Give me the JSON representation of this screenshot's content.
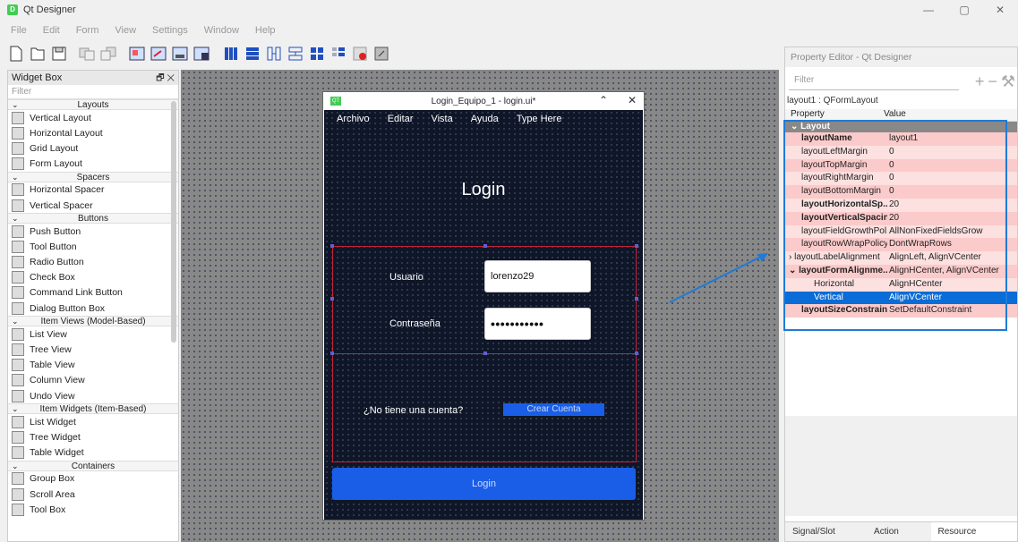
{
  "app": {
    "title": "Qt Designer"
  },
  "window_controls": {
    "minimize": "—",
    "restore": "▢",
    "close": "✕"
  },
  "menu": [
    "File",
    "Edit",
    "Form",
    "View",
    "Settings",
    "Window",
    "Help"
  ],
  "widget_box": {
    "title": "Widget Box",
    "filter_placeholder": "Filter",
    "items": [
      {
        "type": "cat",
        "label": "Layouts"
      },
      {
        "type": "item",
        "label": "Vertical Layout",
        "icon": "vertical-layout-icon"
      },
      {
        "type": "item",
        "label": "Horizontal Layout",
        "icon": "horizontal-layout-icon"
      },
      {
        "type": "item",
        "label": "Grid Layout",
        "icon": "grid-layout-icon"
      },
      {
        "type": "item",
        "label": "Form Layout",
        "icon": "form-layout-icon"
      },
      {
        "type": "cat",
        "label": "Spacers"
      },
      {
        "type": "item",
        "label": "Horizontal Spacer",
        "icon": "horizontal-spacer-icon"
      },
      {
        "type": "item",
        "label": "Vertical Spacer",
        "icon": "vertical-spacer-icon"
      },
      {
        "type": "cat",
        "label": "Buttons"
      },
      {
        "type": "item",
        "label": "Push Button",
        "icon": "push-button-icon"
      },
      {
        "type": "item",
        "label": "Tool Button",
        "icon": "tool-button-icon"
      },
      {
        "type": "item",
        "label": "Radio Button",
        "icon": "radio-button-icon"
      },
      {
        "type": "item",
        "label": "Check Box",
        "icon": "check-box-icon"
      },
      {
        "type": "item",
        "label": "Command Link Button",
        "icon": "command-link-icon"
      },
      {
        "type": "item",
        "label": "Dialog Button Box",
        "icon": "dialog-button-box-icon"
      },
      {
        "type": "cat",
        "label": "Item Views (Model-Based)"
      },
      {
        "type": "item",
        "label": "List View",
        "icon": "list-view-icon"
      },
      {
        "type": "item",
        "label": "Tree View",
        "icon": "tree-view-icon"
      },
      {
        "type": "item",
        "label": "Table View",
        "icon": "table-view-icon"
      },
      {
        "type": "item",
        "label": "Column View",
        "icon": "column-view-icon"
      },
      {
        "type": "item",
        "label": "Undo View",
        "icon": "undo-view-icon"
      },
      {
        "type": "cat",
        "label": "Item Widgets (Item-Based)"
      },
      {
        "type": "item",
        "label": "List Widget",
        "icon": "list-widget-icon"
      },
      {
        "type": "item",
        "label": "Tree Widget",
        "icon": "tree-widget-icon"
      },
      {
        "type": "item",
        "label": "Table Widget",
        "icon": "table-widget-icon"
      },
      {
        "type": "cat",
        "label": "Containers"
      },
      {
        "type": "item",
        "label": "Group Box",
        "icon": "group-box-icon"
      },
      {
        "type": "item",
        "label": "Scroll Area",
        "icon": "scroll-area-icon"
      },
      {
        "type": "item",
        "label": "Tool Box",
        "icon": "tool-box-icon"
      }
    ]
  },
  "form": {
    "window_title": "Login_Equipo_1 - login.ui*",
    "menu": [
      "Archivo",
      "Editar",
      "Vista",
      "Ayuda",
      "Type Here"
    ],
    "heading": "Login",
    "user_label": "Usuario",
    "user_value": "lorenzo29",
    "password_label": "Contraseña",
    "password_value": "•••••••••••",
    "no_account_label": "¿No tiene una cuenta?",
    "create_account_button": "Crear Cuenta",
    "login_button": "Login"
  },
  "property_editor": {
    "title": "Property Editor - Qt Designer",
    "filter_placeholder": "Filter",
    "object": "layout1 : QFormLayout",
    "col_property": "Property",
    "col_value": "Value",
    "group": "Layout",
    "rows": [
      {
        "k": "layoutName",
        "v": "layout1",
        "bold": true,
        "shade": "a"
      },
      {
        "k": "layoutLeftMargin",
        "v": "0",
        "bold": false,
        "shade": "b"
      },
      {
        "k": "layoutTopMargin",
        "v": "0",
        "bold": false,
        "shade": "a"
      },
      {
        "k": "layoutRightMargin",
        "v": "0",
        "bold": false,
        "shade": "b"
      },
      {
        "k": "layoutBottomMargin",
        "v": "0",
        "bold": false,
        "shade": "a"
      },
      {
        "k": "layoutHorizontalSp...",
        "v": "20",
        "bold": true,
        "shade": "b"
      },
      {
        "k": "layoutVerticalSpacing",
        "v": "20",
        "bold": true,
        "shade": "a"
      },
      {
        "k": "layoutFieldGrowthPol...",
        "v": "AllNonFixedFieldsGrow",
        "bold": false,
        "shade": "b"
      },
      {
        "k": "layoutRowWrapPolicy",
        "v": "DontWrapRows",
        "bold": false,
        "shade": "a"
      },
      {
        "k": "layoutLabelAlignment",
        "v": "AlignLeft, AlignVCenter",
        "bold": false,
        "shade": "b",
        "caret": "›"
      },
      {
        "k": "layoutFormAlignme...",
        "v": "AlignHCenter, AlignVCenter",
        "bold": true,
        "shade": "a",
        "caret": "⌄"
      },
      {
        "k": "Horizontal",
        "v": "AlignHCenter",
        "bold": false,
        "shade": "b",
        "sub": true
      },
      {
        "k": "Vertical",
        "v": "AlignVCenter",
        "bold": false,
        "shade": "sel",
        "sub": true
      },
      {
        "k": "layoutSizeConstraint",
        "v": "SetDefaultConstraint",
        "bold": true,
        "shade": "a"
      }
    ],
    "tabs": [
      "Signal/Slot Editor",
      "Action Editor",
      "Resource Browser"
    ]
  },
  "colors": {
    "accent": "#1a5ee8",
    "form_bg": "#0e1628",
    "highlight": "#1f7bd6"
  }
}
